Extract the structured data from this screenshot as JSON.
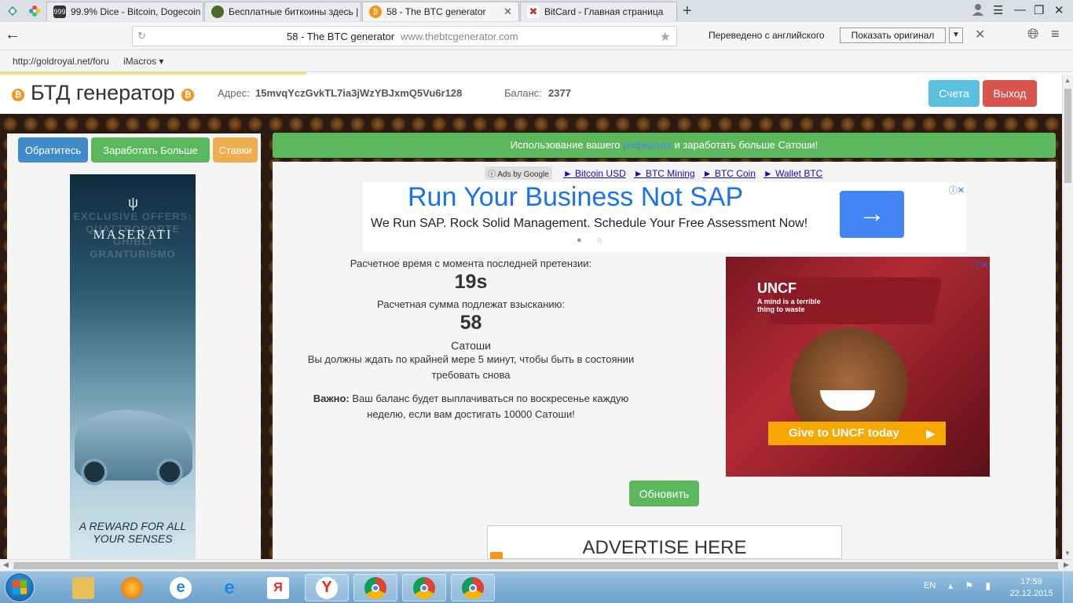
{
  "browser": {
    "tabs": [
      {
        "label": "99.9% Dice - Bitcoin, Dogecoin",
        "favicon": "999"
      },
      {
        "label": "Бесплатные биткоины здесь |"
      },
      {
        "label": "58 - The BTC generator",
        "active": true
      },
      {
        "label": "BitCard - Главная страница"
      }
    ],
    "omnibox": {
      "title": "58 - The BTC generator",
      "url": "www.thebtcgenerator.com"
    },
    "translate": {
      "notice": "Переведено с английского",
      "show_original": "Показать оригинал"
    },
    "bookmarks": [
      "http://goldroyal.net/foru",
      "iMacros ▾"
    ]
  },
  "site": {
    "title": "БТД генератор",
    "address_label": "Адрес:",
    "address": "15mvqYczGvkTL7ia3jWzYBJxmQ5Vu6r128",
    "balance_label": "Баланс:",
    "balance": "2377",
    "accounts_button": "Счета",
    "exit_button": "Выход"
  },
  "left": {
    "contact_button": "Обратитесь",
    "earn_button": "Заработать Больше",
    "bets_button": "Ставки",
    "ad": {
      "exclusive": "EXCLUSIVE OFFERS: QUATTROPORTE GHIBLI GRANTURISMO",
      "brand": "MASERATI",
      "reward": "A REWARD FOR ALL YOUR SENSES"
    }
  },
  "referral": {
    "before": "Использование вашего",
    "link": "реферала",
    "after": "и заработать больше Сатоши!"
  },
  "ads": {
    "ads_by_google": "Ads by Google",
    "links": [
      "► Bitcoin USD",
      "► BTC Mining",
      "► BTC Coin",
      "► Wallet BTC"
    ],
    "sap": {
      "title": "Run Your Business Not SAP",
      "subtitle": "We Run SAP. Rock Solid Management. Schedule Your Free Assessment Now!",
      "dots": "● ○"
    },
    "uncf": {
      "logo": "UNCF",
      "tagline": "A mind is a terrible thing to waste",
      "cta": "Give to UNCF today"
    },
    "advertise": "ADVERTISE HERE"
  },
  "claim": {
    "time_label": "Расчетное время с момента последней претензии:",
    "time_value": "19s",
    "amount_label": "Расчетная сумма подлежат взысканию:",
    "amount_value": "58",
    "unit": "Сатоши",
    "wait_note": "Вы должны ждать по крайней мере 5 минут, чтобы быть в состоянии требовать снова",
    "important_label": "Важно:",
    "important_text": "Ваш баланс будет выплачиваться по воскресенье каждую неделю, если вам достигать 10000 Сатоши!",
    "refresh_button": "Обновить"
  },
  "taskbar": {
    "lang": "EN",
    "time": "17:59",
    "date": "22.12.2015"
  },
  "colors": {
    "green": "#5cb85c",
    "blue": "#428bca",
    "orange": "#f0ad4e",
    "red": "#d9534f",
    "info": "#5bc0de",
    "bitcoin": "#f7931a"
  }
}
